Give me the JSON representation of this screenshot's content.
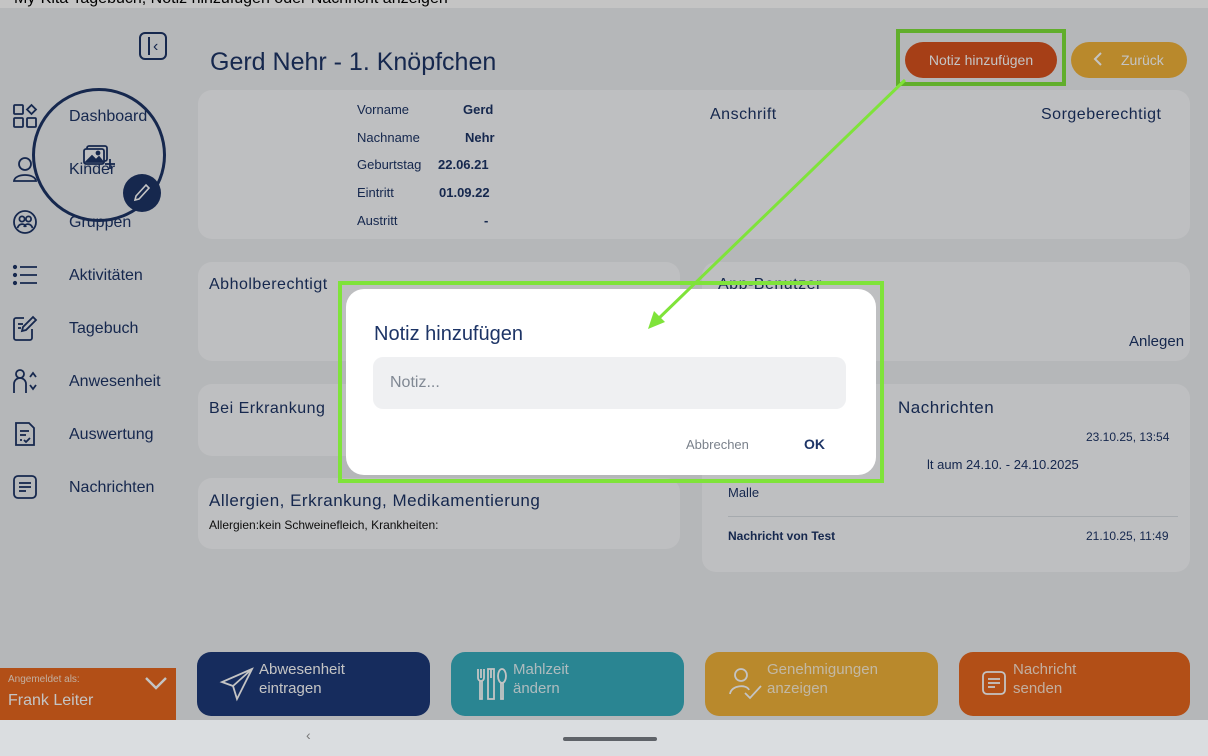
{
  "top_crop_text": "My-Kita Tagebuch, Notiz hinzufügen oder Nachricht anzeigen",
  "sidebar": {
    "items": [
      {
        "label": "Dashboard",
        "icon": "dashboard-icon"
      },
      {
        "label": "Kinder",
        "icon": "person-icon"
      },
      {
        "label": "Gruppen",
        "icon": "group-icon"
      },
      {
        "label": "Aktivitäten",
        "icon": "list-icon"
      },
      {
        "label": "Tagebuch",
        "icon": "edit-icon"
      },
      {
        "label": "Anwesenheit",
        "icon": "attendance-icon"
      },
      {
        "label": "Auswertung",
        "icon": "report-icon"
      },
      {
        "label": "Nachrichten",
        "icon": "message-icon"
      }
    ],
    "logged_in_label": "Angemeldet als:",
    "logged_in_user": "Frank Leiter"
  },
  "header": {
    "title": "Gerd Nehr - 1. Knöpfchen",
    "add_note_label": "Notiz hinzufügen",
    "back_label": "Zurück"
  },
  "child": {
    "fields": [
      {
        "label": "Vorname",
        "value": "Gerd"
      },
      {
        "label": "Nachname",
        "value": "Nehr"
      },
      {
        "label": "Geburtstag",
        "value": "22.06.21"
      },
      {
        "label": "Eintritt",
        "value": "01.09.22"
      },
      {
        "label": "Austritt",
        "value": "-"
      }
    ]
  },
  "cards": {
    "anschrift": "Anschrift",
    "sorgeberechtigt": "Sorgeberechtigt",
    "abholberechtigt": "Abholberechtigt",
    "app_benutzer": "App-Benutzer",
    "anlegen": "Anlegen",
    "erkrankung": "Bei Erkrankung",
    "nachrichten": "Nachrichten",
    "allergien_title": "Allergien, Erkrankung, Medikamentierung",
    "allergien_text": "Allergien:kein Schweinefleich, Krankheiten:"
  },
  "messages": {
    "m1_time": "23.10.25, 13:54",
    "m1_line": "lt aum 24.10. - 24.10.2025",
    "m1_text": "Malle",
    "m2_sender": "Nachricht von Test",
    "m2_time": "21.10.25, 11:49"
  },
  "actions": [
    {
      "line1": "Abwesenheit",
      "line2": "eintragen",
      "color": "#1d3a7a"
    },
    {
      "line1": "Mahlzeit",
      "line2": "ändern",
      "color": "#37aebf"
    },
    {
      "line1": "Genehmigungen",
      "line2": "anzeigen",
      "color": "#f1b33a"
    },
    {
      "line1": "Nachricht",
      "line2": "senden",
      "color": "#e8671f"
    }
  ],
  "dialog": {
    "title": "Notiz hinzufügen",
    "placeholder": "Notiz...",
    "value": "",
    "cancel_label": "Abbrechen",
    "ok_label": "OK"
  },
  "colors": {
    "primary": "#1d3466",
    "orange": "#e8671f",
    "highlight": "#7fe33a"
  }
}
